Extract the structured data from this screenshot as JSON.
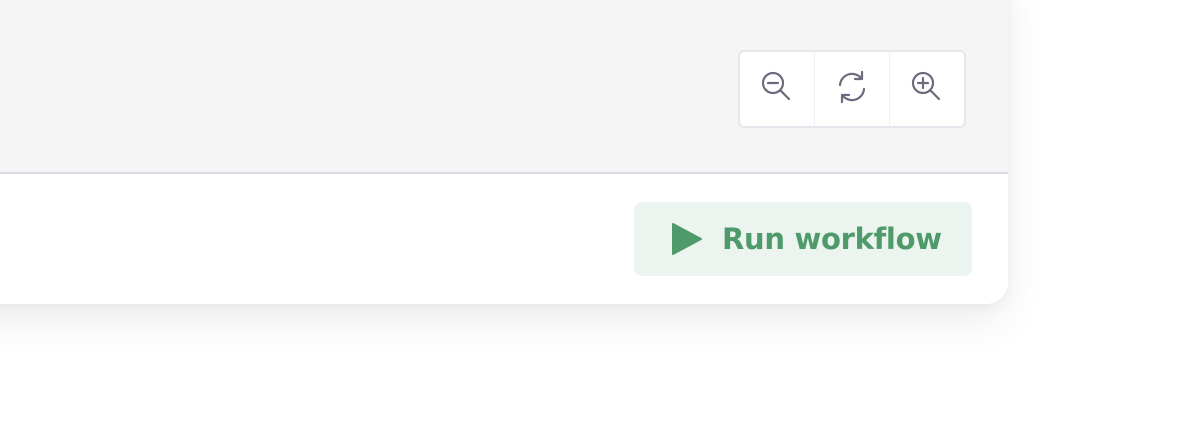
{
  "toolbar": {
    "zoom_out_icon": "zoom-out-icon",
    "reset_icon": "refresh-icon",
    "zoom_in_icon": "zoom-in-icon"
  },
  "footer": {
    "run_label": "Run workflow",
    "run_icon": "play-icon"
  },
  "colors": {
    "canvas_bg": "#f5f5f5",
    "accent_green": "#4e9a6a",
    "run_button_bg": "#ebf4ee",
    "icon_gray": "#6c6a7c"
  }
}
